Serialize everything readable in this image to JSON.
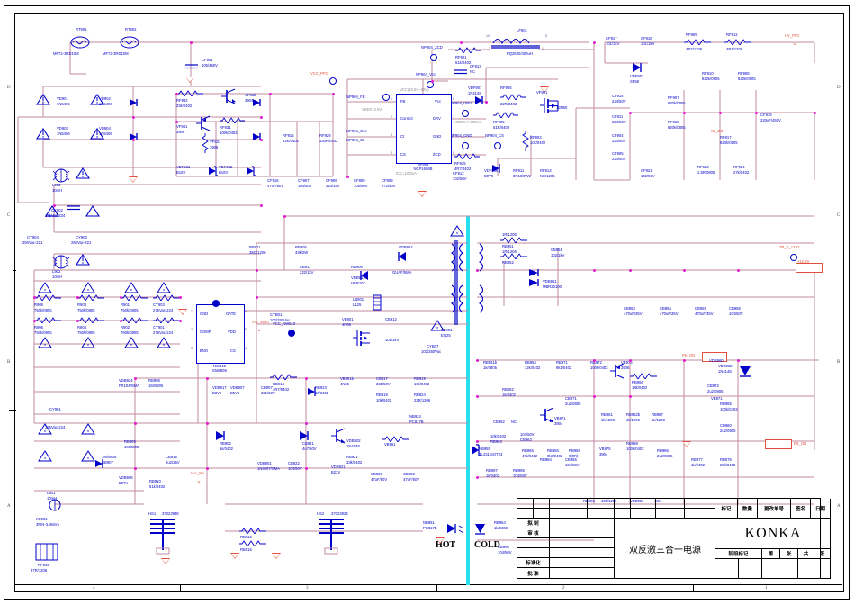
{
  "sheet": {
    "title_cn": "双反激三合一电源",
    "brand": "KONKA",
    "zones_top": [
      "4",
      "3",
      "2",
      "1"
    ],
    "zones_side": [
      "D",
      "C",
      "B",
      "A"
    ]
  },
  "title_block": {
    "rev_headers": [
      "标记",
      "数量",
      "更改单号",
      "签名",
      "日期"
    ],
    "stage_header": "阶段标记",
    "sheet_labels": [
      "第",
      "张",
      "共",
      "张"
    ],
    "rows": [
      "拟 制",
      "审 核",
      "",
      "",
      "标准化",
      "批 准"
    ]
  },
  "barrier": {
    "hot": "HOT",
    "cold": "COLD"
  },
  "nets": [
    {
      "name": "HV_PFC"
    },
    {
      "name": "VCC_PFC"
    },
    {
      "name": "Vcc_Na"
    },
    {
      "name": "Vcc_8520"
    },
    {
      "name": "VCC_NW910"
    },
    {
      "name": "PS_ON"
    },
    {
      "name": "SL_BO"
    },
    {
      "name": "TP_V_12V2"
    },
    {
      "name": "+12.2V"
    }
  ],
  "ics": [
    {
      "ref": "NP904",
      "part": "NCP1606B",
      "pins_left": [
        "FB",
        "Control",
        "Ct",
        "CS"
      ],
      "pins_right": [
        "Vcc",
        "DRV",
        "GND",
        "ZCD"
      ],
      "note_top": "VCC(10.5V~20V)",
      "note_bottom": "ICC=100mA",
      "note_fb": "VREF=2.5V",
      "note_drv": "+500mA/-800mA"
    },
    {
      "ref": "NW910",
      "part": "EM8808",
      "pins_left": [
        "GND",
        "COMP",
        "BNO"
      ],
      "pins_right": [
        "GATE",
        "VDD",
        "CS"
      ]
    },
    {
      "ref": "NB951",
      "part": "PC817B"
    },
    {
      "ref": "NB955",
      "part": "TL431/SOT23"
    }
  ],
  "components": [
    {
      "ref": "RT901",
      "val": "MF72-3RD10M"
    },
    {
      "ref": "RT902",
      "val": "MF72-3RD10M"
    },
    {
      "ref": "CF901",
      "val": "105/450V"
    },
    {
      "ref": "VD901",
      "val": "1N5406"
    },
    {
      "ref": "VD902",
      "val": "1N5406"
    },
    {
      "ref": "VD903",
      "val": "1N5406"
    },
    {
      "ref": "VD904",
      "val": "1N5406"
    },
    {
      "ref": "L903",
      "val": "10mH"
    },
    {
      "ref": "L902",
      "val": "10mH"
    },
    {
      "ref": "L901",
      "val": "10mH"
    },
    {
      "ref": "CX902",
      "val": "275Vac-334"
    },
    {
      "ref": "CY904",
      "val": "250Vac-221"
    },
    {
      "ref": "CY903",
      "val": "250Vac-221"
    },
    {
      "ref": "CY901",
      "val": "275Vac-224"
    },
    {
      "ref": "R901",
      "val": "750k/0805"
    },
    {
      "ref": "R902",
      "val": "750k/0805"
    },
    {
      "ref": "R903",
      "val": "750k/0805"
    },
    {
      "ref": "R904",
      "val": "750k/0805"
    },
    {
      "ref": "R905",
      "val": "750k/0805"
    },
    {
      "ref": "R906",
      "val": "750k/0805"
    },
    {
      "ref": "R907",
      "val": "750k/0805"
    },
    {
      "ref": "R908",
      "val": "750k/0805"
    },
    {
      "ref": "FR11",
      "val": "250V,T5AL"
    },
    {
      "ref": "XS901",
      "val": "3PIN-3.96mm"
    },
    {
      "ref": "RF934",
      "val": "47R/1206"
    },
    {
      "ref": "RF932",
      "val": "33k/0402"
    },
    {
      "ref": "RF931",
      "val": "100k/0402"
    },
    {
      "ref": "VF931",
      "val": "3906"
    },
    {
      "ref": "VF932",
      "val": "3904"
    },
    {
      "ref": "VDF931",
      "val": "B16V"
    },
    {
      "ref": "VDF932",
      "val": "B16V"
    },
    {
      "ref": "CF916",
      "val": "47uF/50V"
    },
    {
      "ref": "CF907",
      "val": "104/50V"
    },
    {
      "ref": "CF906",
      "val": "224/16V"
    },
    {
      "ref": "CF908",
      "val": "105/50V"
    },
    {
      "ref": "CF909",
      "val": "272/50V"
    },
    {
      "ref": "RF916",
      "val": "22K/0402"
    },
    {
      "ref": "RF929",
      "val": "330R/0402"
    },
    {
      "ref": "RF921",
      "val": "51k/0402"
    },
    {
      "ref": "CF913",
      "val": "NC"
    },
    {
      "ref": "LF901",
      "val": "PQ2620/400uH"
    },
    {
      "ref": "VDF907",
      "val": "1N4148"
    },
    {
      "ref": "RF906",
      "val": "22R/0402"
    },
    {
      "ref": "RF905",
      "val": "51R/0402"
    },
    {
      "ref": "RF903",
      "val": "10k/0402"
    },
    {
      "ref": "RF925",
      "val": "4R7/0402"
    },
    {
      "ref": "CF912",
      "val": "102/50V"
    },
    {
      "ref": "VDF906",
      "val": "B0V9"
    },
    {
      "ref": "RF911",
      "val": "0R18/0W1"
    },
    {
      "ref": "RF913",
      "val": "NC/1206"
    },
    {
      "ref": "VF901",
      "val": "13N50"
    },
    {
      "ref": "CF914",
      "val": "224/50V"
    },
    {
      "ref": "CF911",
      "val": "224/50V"
    },
    {
      "ref": "CF904",
      "val": "224/50V"
    },
    {
      "ref": "CF905",
      "val": "224/50V"
    },
    {
      "ref": "CF921",
      "val": "102/50V"
    },
    {
      "ref": "CF917",
      "val": "101/1kV"
    },
    {
      "ref": "CF918",
      "val": "101/1kV"
    },
    {
      "ref": "RF909",
      "val": "4R7/1206"
    },
    {
      "ref": "RF912",
      "val": "4R7/1206"
    },
    {
      "ref": "VDF901",
      "val": "SF58"
    },
    {
      "ref": "RF910",
      "val": "820k/0805"
    },
    {
      "ref": "RF908",
      "val": "820k/0805"
    },
    {
      "ref": "RF907",
      "val": "820k/0805"
    },
    {
      "ref": "RF915",
      "val": "820k/0805"
    },
    {
      "ref": "RF917",
      "val": "820k/0805"
    },
    {
      "ref": "RF923",
      "val": "1.5R/0805"
    },
    {
      "ref": "RF924",
      "val": "27k/0402"
    },
    {
      "ref": "CF919",
      "val": "220uF/450V"
    },
    {
      "ref": "RB911",
      "val": "3M3/1206"
    },
    {
      "ref": "RB905",
      "val": "33k/2W"
    },
    {
      "ref": "CB911",
      "val": "222/1kV"
    },
    {
      "ref": "RB906",
      "val": "22R/1206"
    },
    {
      "ref": "VDB911",
      "val": "HER107"
    },
    {
      "ref": "VDB912",
      "val": "GUAF/5MA"
    },
    {
      "ref": "LB901",
      "val": "L125"
    },
    {
      "ref": "VB901",
      "val": "4N65"
    },
    {
      "ref": "CB912",
      "val": "101/1kV"
    },
    {
      "ref": "TB901",
      "val": "EQ25"
    },
    {
      "ref": "CYB07",
      "val": "102/250Vac"
    },
    {
      "ref": "CYB01",
      "val": "102/250Vac"
    },
    {
      "ref": "VB914",
      "val": "5160"
    },
    {
      "ref": "VB901b",
      "val": "4N65"
    },
    {
      "ref": "RB914",
      "val": "4R7/0402"
    },
    {
      "ref": "RB923",
      "val": "10/0402"
    },
    {
      "ref": "VDB917",
      "val": "B3V9"
    },
    {
      "ref": "VDB907",
      "val": "B5V6"
    },
    {
      "ref": "CB907",
      "val": "331/50V"
    },
    {
      "ref": "CB917",
      "val": "331/50V"
    },
    {
      "ref": "RB918",
      "val": "10k/0402"
    },
    {
      "ref": "RB919",
      "val": "10k/0402"
    },
    {
      "ref": "RB924",
      "val": "22R/1206"
    },
    {
      "ref": "NB924",
      "val": "PC817B"
    },
    {
      "ref": "VDB924",
      "val": "FR104/SMA"
    },
    {
      "ref": "RB908",
      "val": "1M/0805"
    },
    {
      "ref": "RB909",
      "val": "1M/0805"
    },
    {
      "ref": "RB907",
      "val": "1M/0805"
    },
    {
      "ref": "VDB908",
      "val": "B27V"
    },
    {
      "ref": "RB910",
      "val": "51k/0402"
    },
    {
      "ref": "CB918",
      "val": "2u2/25V"
    },
    {
      "ref": "RB903",
      "val": "1k/0402"
    },
    {
      "ref": "RB902",
      "val": "1k/0402"
    },
    {
      "ref": "VDB901",
      "val": "1N4007/SMA"
    },
    {
      "ref": "CB922",
      "val": "104/50V"
    },
    {
      "ref": "CB921",
      "val": "4u7/50V"
    },
    {
      "ref": "VDB902",
      "val": "1N4148"
    },
    {
      "ref": "VB961",
      "val": "3904"
    },
    {
      "ref": "RB921",
      "val": "33k/0402"
    },
    {
      "ref": "VDB921",
      "val": "B22V"
    },
    {
      "ref": "CB920",
      "val": "47uF/50V"
    },
    {
      "ref": "CB903",
      "val": "47uF/50V"
    },
    {
      "ref": "HS1",
      "val": "37023938"
    },
    {
      "ref": "HS2",
      "val": "37023938"
    },
    {
      "ref": "RB912",
      "val": "0/1206"
    },
    {
      "ref": "RB916",
      "val": "0/1206"
    },
    {
      "ref": "RB951",
      "val": "1R/1206"
    },
    {
      "ref": "RB952",
      "val": "1R/1206"
    },
    {
      "ref": "CB951",
      "val": "102/1kV"
    },
    {
      "ref": "VDB951",
      "val": "MBR20100"
    },
    {
      "ref": "CB953",
      "val": "470uF/35V"
    },
    {
      "ref": "CB954",
      "val": "470uF/35V"
    },
    {
      "ref": "CB955",
      "val": "470uF/35V"
    },
    {
      "ref": "CB956",
      "val": "104/50V"
    },
    {
      "ref": "RB951b",
      "val": "1k/0805"
    },
    {
      "ref": "RB962",
      "val": "1k/0402"
    },
    {
      "ref": "RB954",
      "val": "12k/0402"
    },
    {
      "ref": "RB971",
      "val": "9k1/0402"
    },
    {
      "ref": "RB972",
      "val": "100k/0402"
    },
    {
      "ref": "CB962",
      "val": "NC"
    },
    {
      "ref": "RB963",
      "val": "10k/0402"
    },
    {
      "ref": "CB963",
      "val": "104/50V"
    },
    {
      "ref": "VB971",
      "val": "3904"
    },
    {
      "ref": "CB971",
      "val": "2u2/0805"
    },
    {
      "ref": "RB965",
      "val": "47k/0402"
    },
    {
      "ref": "RB955",
      "val": "0k3/0402"
    },
    {
      "ref": "RB968",
      "val": "0(0R)"
    },
    {
      "ref": "VB975",
      "val": "3904"
    },
    {
      "ref": "VB973",
      "val": "3906"
    },
    {
      "ref": "RB966",
      "val": "18k/0402"
    },
    {
      "ref": "RB961",
      "val": "1k/1206"
    },
    {
      "ref": "RB962b",
      "val": "1k/1206"
    },
    {
      "ref": "RB967",
      "val": "1k/1206"
    },
    {
      "ref": "VDB962",
      "val": "1N4148"
    },
    {
      "ref": "CB972",
      "val": "2u2/0805"
    },
    {
      "ref": "RB985",
      "val": "100k/0402"
    },
    {
      "ref": "CB960",
      "val": "2u2/0805"
    },
    {
      "ref": "VDB960",
      "val": "1N4148"
    },
    {
      "ref": "RB988",
      "val": "100k/0402"
    },
    {
      "ref": "RB986",
      "val": "2u2/0805"
    },
    {
      "ref": "RB977",
      "val": "1k/0402"
    },
    {
      "ref": "RB976",
      "val": "20k/0402"
    },
    {
      "ref": "RB983",
      "val": "100/1206"
    },
    {
      "ref": "VDB981",
      "val": "13V"
    },
    {
      "ref": "RB964",
      "val": "1k/0402"
    },
    {
      "ref": "CB965",
      "val": "104/50V"
    },
    {
      "ref": "RB984",
      "val": "0/0402"
    },
    {
      "ref": "CB996",
      "val": "104/50V"
    },
    {
      "ref": "RB997",
      "val": "1k/0402"
    },
    {
      "ref": "VB977",
      "val": "3904"
    },
    {
      "ref": "RB995",
      "val": "104/58V"
    },
    {
      "ref": "NB995",
      "val": "TL431/SOT23"
    },
    {
      "ref": "VB961b",
      "val": "3804"
    },
    {
      "ref": "RB998",
      "val": "9k1/0402"
    },
    {
      "ref": "NB951",
      "val": "PC817B"
    },
    {
      "ref": "RB907b",
      "val": "1M/0805"
    },
    {
      "ref": "R27V",
      "val": "VDB908"
    }
  ],
  "signal_labels": [
    "NP904_ZCD",
    "NP904_Vcc",
    "NP904_FB",
    "NP904_Coe",
    "NP904_Ct",
    "NP904_DRV",
    "NP904_GND",
    "NP904_CS",
    "VCC_PFC",
    "HV_PFC",
    "SL_BO",
    "TP_V_12V2",
    "+12.2V",
    "PS_ON",
    "Vcc_Na",
    "Vcc_8520",
    "VCC_NW910",
    "GND",
    "GATE",
    "COMP",
    "VDD",
    "BNO",
    "CS",
    "HOT",
    "COLD"
  ]
}
